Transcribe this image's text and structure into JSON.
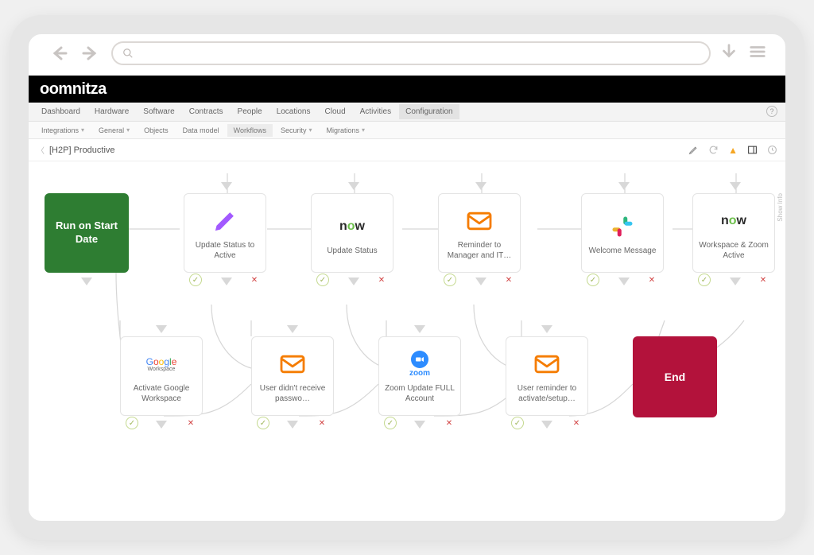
{
  "brand": "oomnitza",
  "addr_placeholder": "",
  "main_nav": [
    "Dashboard",
    "Hardware",
    "Software",
    "Contracts",
    "People",
    "Locations",
    "Cloud",
    "Activities",
    "Configuration"
  ],
  "main_nav_active": "Configuration",
  "sub_nav": [
    {
      "label": "Integrations",
      "caret": true
    },
    {
      "label": "General",
      "caret": true
    },
    {
      "label": "Objects",
      "caret": false
    },
    {
      "label": "Data model",
      "caret": false
    },
    {
      "label": "Workflows",
      "caret": false,
      "active": true
    },
    {
      "label": "Security",
      "caret": true
    },
    {
      "label": "Migrations",
      "caret": true
    }
  ],
  "page_title": "[H2P] Productive",
  "show_info": "Show Info",
  "nodes": {
    "start": "Run on Start Date",
    "update_status_active": "Update Status to Active",
    "update_status": "Update Status",
    "reminder_mgr": "Reminder to Manager and IT…",
    "welcome_msg": "Welcome Message",
    "ws_zoom": "Workspace & Zoom Active",
    "goog_act": "Activate Google Workspace",
    "user_pw": "User didn't receive passwo…",
    "zoom_full": "Zoom Update FULL Account",
    "user_remind": "User reminder to activate/setup…",
    "end": "End",
    "now_label": "now",
    "zoom_label": "zoom",
    "google_workspace_sub": "Workspace"
  }
}
